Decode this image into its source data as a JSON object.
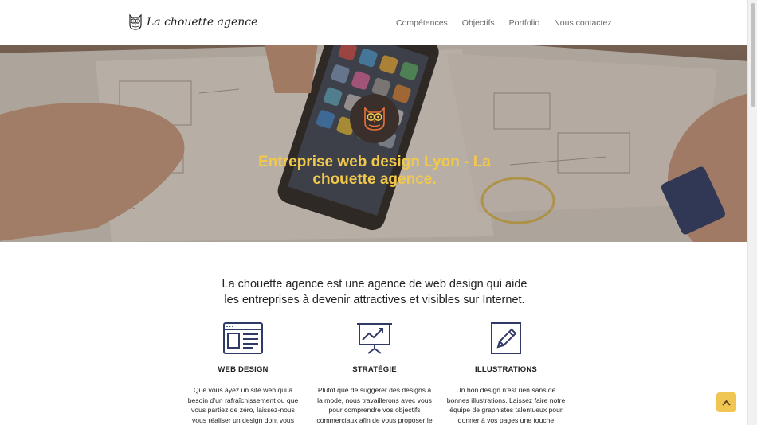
{
  "brand": {
    "name": "La chouette agence",
    "icon": "owl-logo-icon"
  },
  "nav": [
    {
      "label": "Compétences"
    },
    {
      "label": "Objectifs"
    },
    {
      "label": "Portfolio"
    },
    {
      "label": "Nous contactez"
    }
  ],
  "hero": {
    "title": "Entreprise web design Lyon - La chouette agence.",
    "badge_icon": "owl-badge-icon"
  },
  "intro": "La chouette agence est une agence de web design qui aide les entreprises à devenir attractives et visibles sur Internet.",
  "services": [
    {
      "icon": "web-layout-icon",
      "title": "WEB DESIGN",
      "text": "Que vous ayez un site web qui a besoin d’un rafraîchissement ou que vous partiez de zéro, laissez-nous vous réaliser un design dont vous"
    },
    {
      "icon": "presentation-chart-icon",
      "title": "STRATÉGIE",
      "text": "Plutôt que de suggérer des designs à la mode, nous travaillerons avec vous pour comprendre vos objectifs commerciaux afin de vous proposer le"
    },
    {
      "icon": "pencil-icon",
      "title": "ILLUSTRATIONS",
      "text": "Un bon design n'est rien sans de bonnes illustrations. Laissez faire notre équipe de graphistes talentueux pour donner à vos pages une touche"
    }
  ],
  "scroll_top": {
    "icon": "chevron-up-icon"
  },
  "colors": {
    "accent": "#f2c84b",
    "icon_navy": "#2f3a66",
    "badge_bg": "#3a2f2b"
  }
}
